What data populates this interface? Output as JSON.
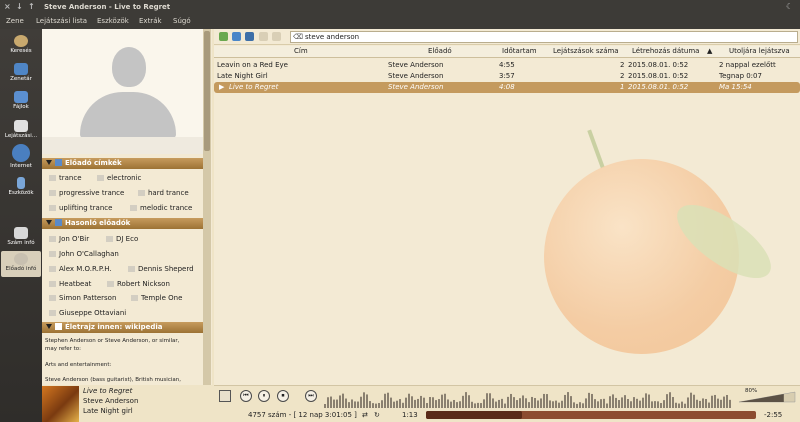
{
  "window": {
    "title": "Steve Anderson - Live to Regret",
    "controls": [
      "×",
      "↓",
      "↑"
    ]
  },
  "menu": [
    "Zene",
    "Lejátszási lista",
    "Eszközök",
    "Extrák",
    "Súgó"
  ],
  "leftbar": [
    {
      "label": "Keresés",
      "icon": "search-icon",
      "color": "#c9a96e"
    },
    {
      "label": "Zenetár",
      "icon": "library-icon",
      "color": "#4f86c6"
    },
    {
      "label": "Fájlok",
      "icon": "folder-icon",
      "color": "#5b8fd0"
    },
    {
      "label": "Lejátszási...",
      "icon": "playlist-icon",
      "color": "#e0e0e0"
    },
    {
      "label": "Internet",
      "icon": "globe-icon",
      "color": "#4a7fc0"
    },
    {
      "label": "Eszközök",
      "icon": "devices-icon",
      "color": "#7aa6d8"
    },
    {
      "label": "Szám infó",
      "icon": "song-info-icon",
      "color": "#d8d8d8"
    },
    {
      "label": "Előadó infó",
      "icon": "artist-info-icon",
      "color": "#c8c0b0"
    }
  ],
  "context": {
    "tags_title": "Előadó címkék",
    "tags": [
      [
        "trance",
        "electronic"
      ],
      [
        "progressive trance",
        "hard trance"
      ],
      [
        "uplifting trance",
        "melodic trance"
      ]
    ],
    "similar_title": "Hasonló előadók",
    "similar": [
      [
        "Jon O'Bir",
        "DJ Eco"
      ],
      [
        "John O'Callaghan"
      ],
      [
        "Alex M.O.R.P.H.",
        "Dennis Sheperd"
      ],
      [
        "Heatbeat",
        "Robert Nickson"
      ],
      [
        "Simon Patterson",
        "Temple One"
      ],
      [
        "Giuseppe Ottaviani"
      ]
    ],
    "bio_title": "Életrajz innen: wikipedia",
    "bio": [
      "Stephen Anderson or Steve Anderson, or similar,",
      "may refer to:",
      "",
      "Arts and entertainment:",
      "",
      "Steve Anderson (bass guitarist), British musician,"
    ]
  },
  "nowplaying": {
    "title": "Live to Regret",
    "artist": "Steve Anderson",
    "album": "Late Night girl"
  },
  "playlist": {
    "filter_value": "steve anderson",
    "columns": [
      "Cím",
      "Előadó",
      "Időtartam",
      "Lejátszások száma",
      "Létrehozás dátuma",
      "Utoljára lejátszva"
    ],
    "sort_indicator": "▲",
    "rows": [
      {
        "title": "Leavin on a Red Eye",
        "artist": "Steve Anderson",
        "length": "4:55",
        "plays": "2",
        "created": "2015.08.01. 0:52",
        "last": "2 nappal ezelőtt"
      },
      {
        "title": "Late Night Girl",
        "artist": "Steve Anderson",
        "length": "3:57",
        "plays": "2",
        "created": "2015.08.01. 0:52",
        "last": "Tegnap 0:07"
      },
      {
        "title": "Live to Regret",
        "artist": "Steve Anderson",
        "length": "4:08",
        "plays": "1",
        "created": "2015.08.01. 0:52",
        "last": "Ma 15:54"
      }
    ]
  },
  "player": {
    "status": "4757 szám - [ 12 nap 3:01:05 ]",
    "elapsed": "1:13",
    "remaining": "-2:55",
    "progress": 0.29,
    "volume_label": "80%",
    "volume": 0.8
  },
  "colors": {
    "accent": "#c49a5e",
    "bg": "#f3ead4",
    "titlebar": "#3d3b37"
  }
}
